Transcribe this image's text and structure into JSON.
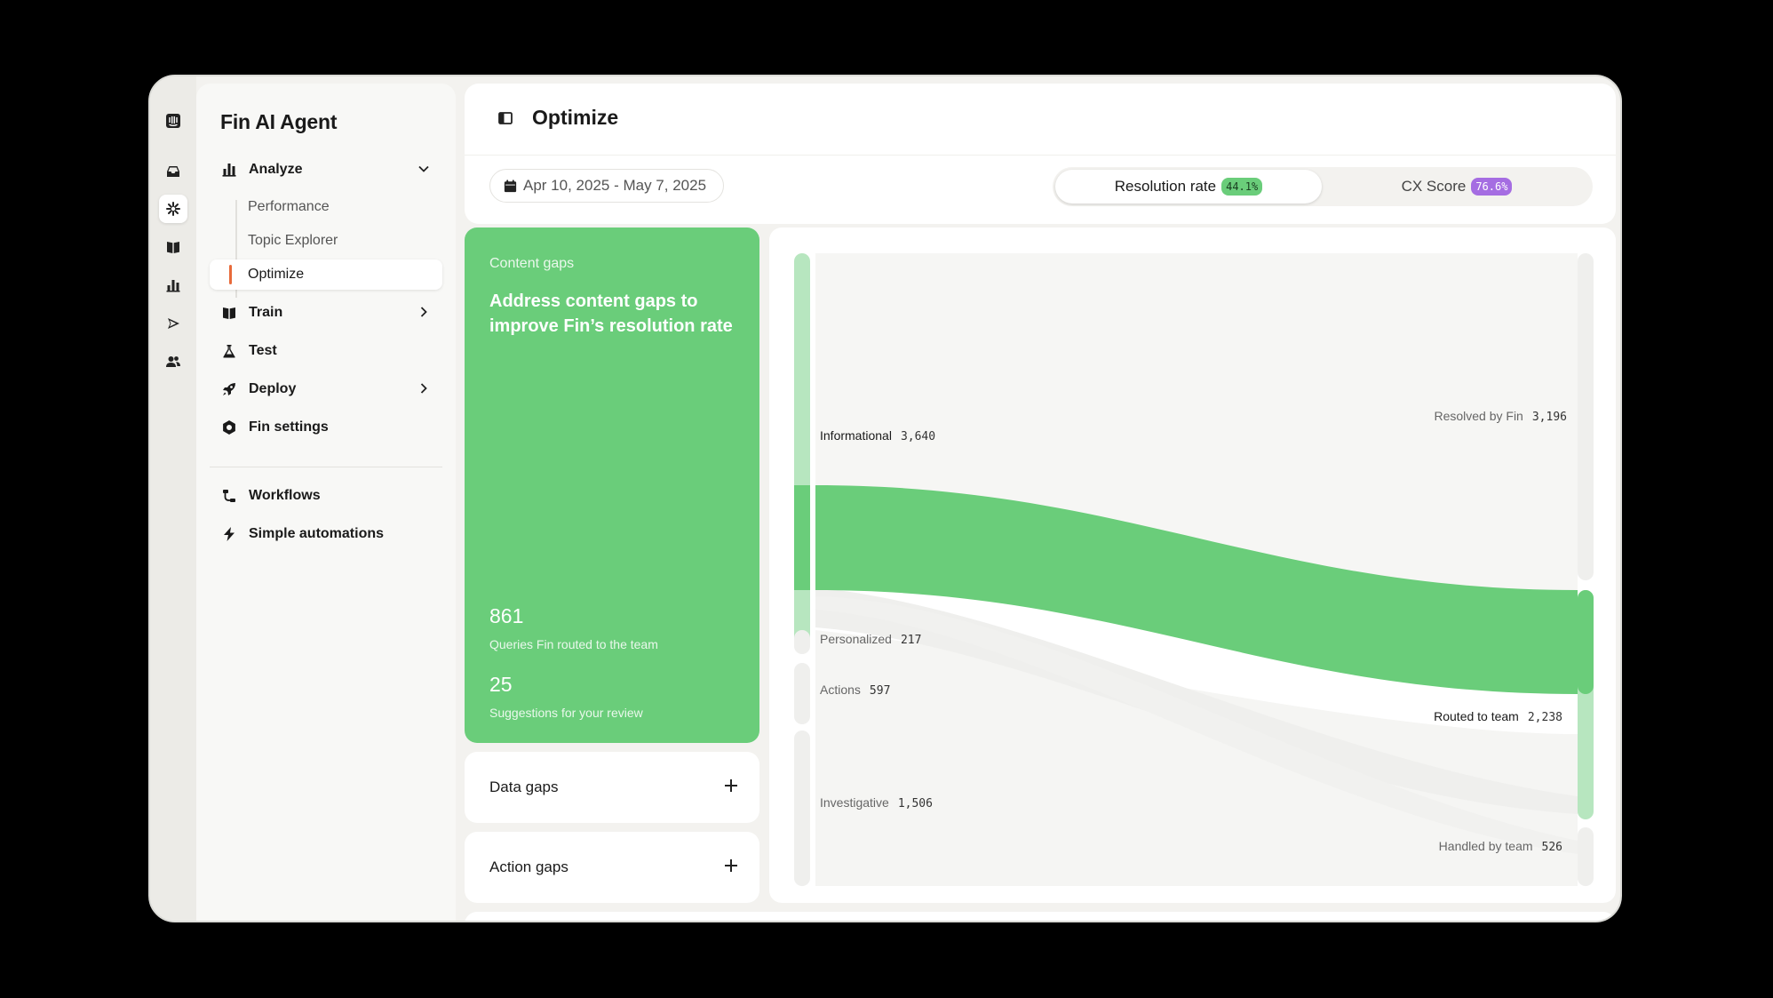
{
  "app": {
    "title": "Fin AI Agent"
  },
  "rail": {
    "icons": [
      "intercom-logo-icon",
      "inbox-icon",
      "fin-icon",
      "knowledge-icon",
      "reports-icon",
      "outbound-icon",
      "contacts-icon"
    ]
  },
  "nav": {
    "analyze": "Analyze",
    "analyze_sub": [
      "Performance",
      "Topic Explorer",
      "Optimize"
    ],
    "train": "Train",
    "test": "Test",
    "deploy": "Deploy",
    "fin_settings": "Fin settings",
    "workflows": "Workflows",
    "simple_automations": "Simple automations"
  },
  "header": {
    "title": "Optimize"
  },
  "filters": {
    "date_range": "Apr 10, 2025 - May 7, 2025",
    "resolution_label": "Resolution rate",
    "resolution_value": "44.1%",
    "cx_label": "CX Score",
    "cx_value": "76.6%",
    "colors": {
      "resolution": "#6acd7a",
      "cx": "#a56de2"
    }
  },
  "content_gaps": {
    "eyebrow": "Content gaps",
    "headline": "Address content gaps to improve Fin’s resolution rate",
    "queries_value": "861",
    "queries_label": "Queries Fin routed to the team",
    "suggestions_value": "25",
    "suggestions_label": "Suggestions for your review"
  },
  "gap_cards": {
    "data": "Data gaps",
    "action": "Action gaps"
  },
  "sankey": {
    "sources": [
      {
        "name": "Informational",
        "value": "3,640"
      },
      {
        "name": "Personalized",
        "value": "217"
      },
      {
        "name": "Actions",
        "value": "597"
      },
      {
        "name": "Investigative",
        "value": "1,506"
      }
    ],
    "targets": [
      {
        "name": "Resolved by Fin",
        "value": "3,196"
      },
      {
        "name": "Routed to team",
        "value": "2,238"
      },
      {
        "name": "Handled by team",
        "value": "526"
      }
    ],
    "highlight_color": "#6acd7a"
  }
}
